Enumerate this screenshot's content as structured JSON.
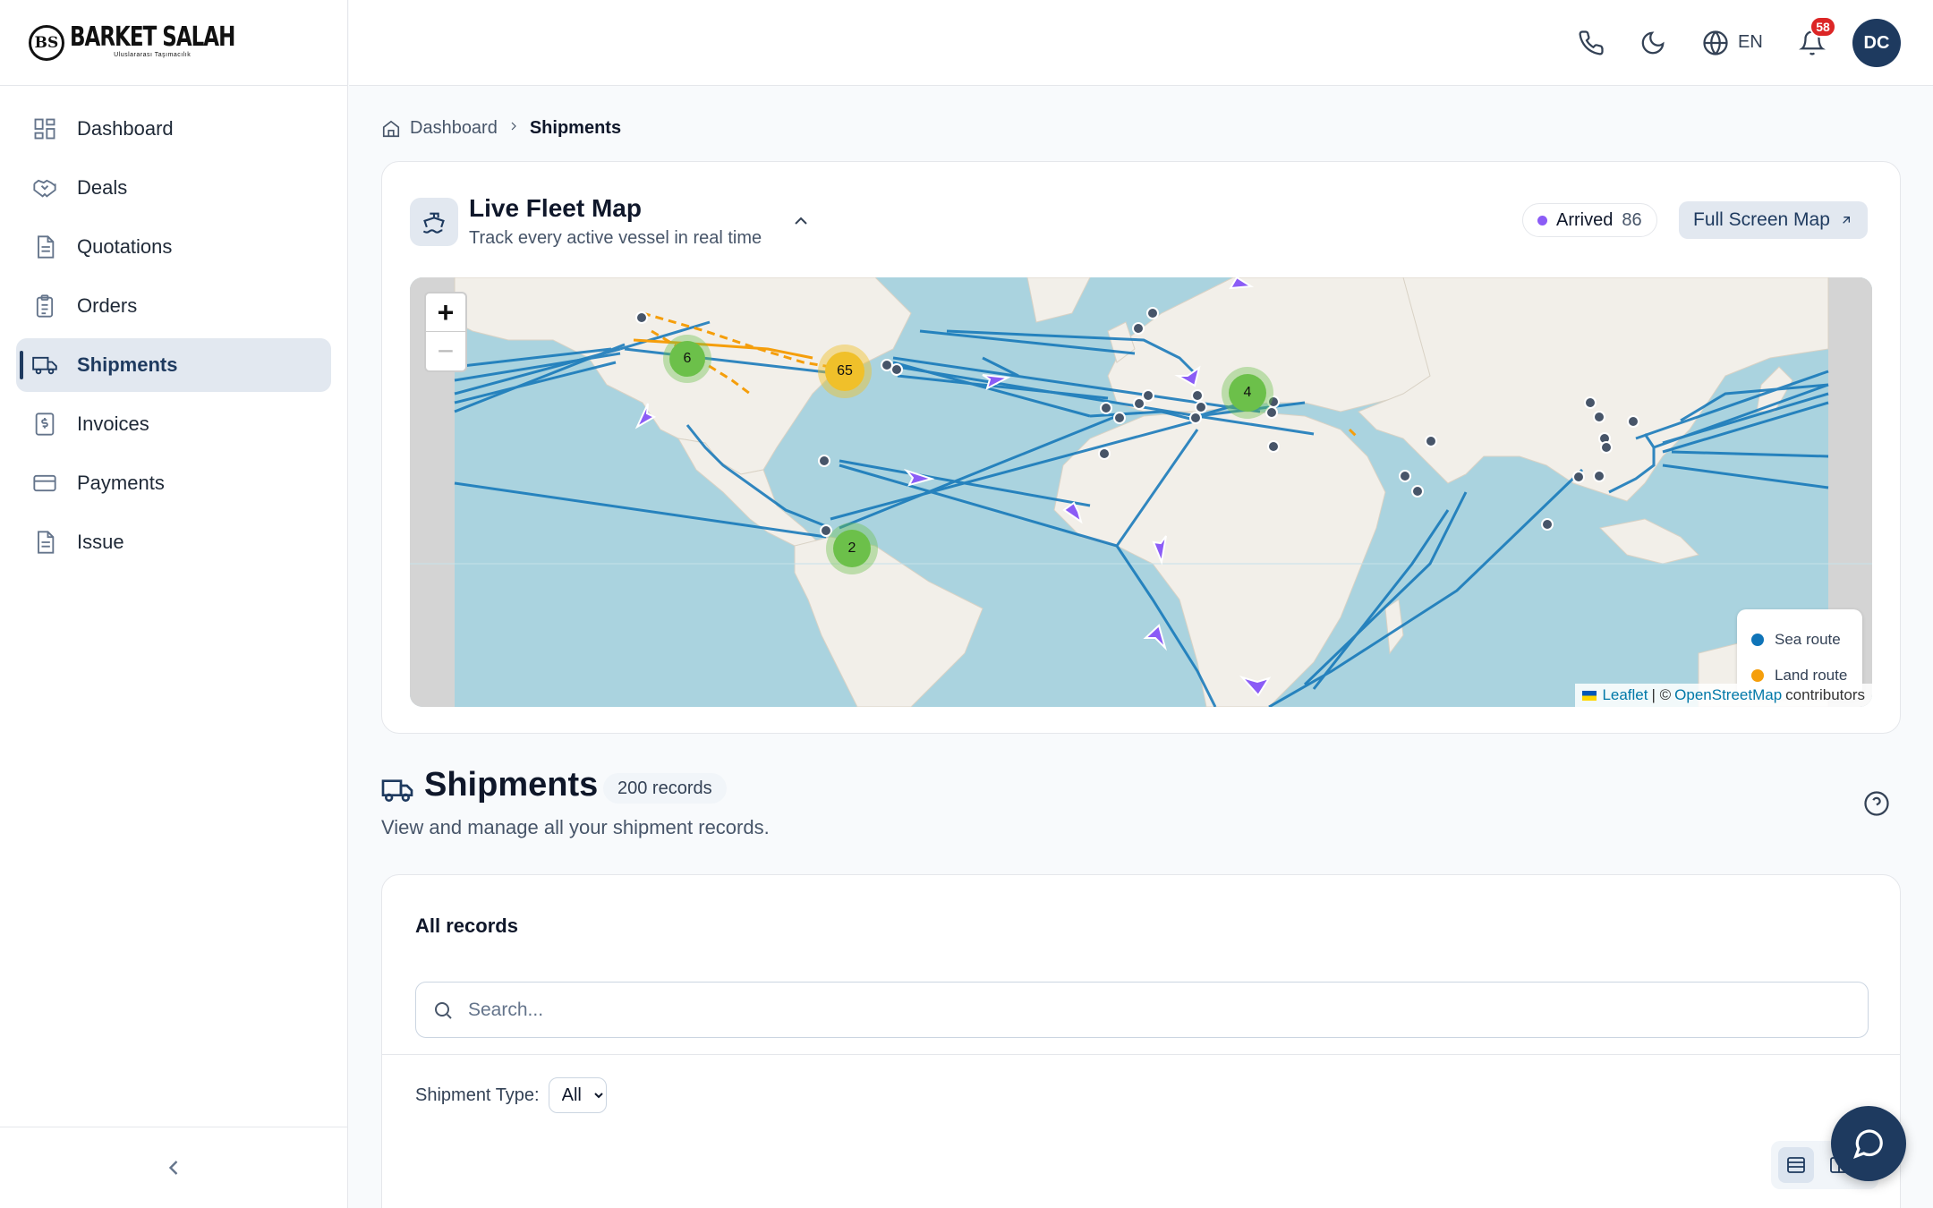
{
  "brand": {
    "mark": "BS",
    "name": "BARKET SALAH",
    "tagline": "Uluslararası Taşımacılık"
  },
  "sidebar": {
    "items": [
      {
        "label": "Dashboard",
        "icon": "dashboard-icon"
      },
      {
        "label": "Deals",
        "icon": "handshake-icon"
      },
      {
        "label": "Quotations",
        "icon": "document-icon"
      },
      {
        "label": "Orders",
        "icon": "clipboard-icon"
      },
      {
        "label": "Shipments",
        "icon": "truck-icon",
        "active": true
      },
      {
        "label": "Invoices",
        "icon": "invoice-icon"
      },
      {
        "label": "Payments",
        "icon": "card-icon"
      },
      {
        "label": "Issue",
        "icon": "file-icon"
      }
    ]
  },
  "header": {
    "language": "EN",
    "notification_count": "58",
    "avatar_initials": "DC"
  },
  "breadcrumb": {
    "home": "Dashboard",
    "current": "Shipments"
  },
  "map_card": {
    "title": "Live Fleet Map",
    "subtitle": "Track every active vessel in real time",
    "arrived_label": "Arrived",
    "arrived_count": "86",
    "full_screen_label": "Full Screen Map",
    "zoom_in": "+",
    "zoom_out": "−",
    "clusters": [
      {
        "count": "6",
        "color": "#6cc04a"
      },
      {
        "count": "65",
        "color": "#f0c02a"
      },
      {
        "count": "4",
        "color": "#6cc04a"
      },
      {
        "count": "2",
        "color": "#6cc04a"
      }
    ],
    "legend": {
      "sea_label": "Sea route",
      "sea_color": "#0f74b8",
      "land_label": "Land route",
      "land_color": "#f59e0b"
    },
    "attribution": {
      "leaflet": "Leaflet",
      "sep": "| ©",
      "osm": "OpenStreetMap",
      "suffix": "contributors"
    }
  },
  "shipments": {
    "title": "Shipments",
    "records_badge": "200 records",
    "subtitle": "View and manage all your shipment records.",
    "card_title": "All records",
    "search_placeholder": "Search...",
    "filter_label": "Shipment Type:",
    "filter_value": "All"
  },
  "colors": {
    "primary": "#1e3a5f",
    "sea": "#aad3df",
    "land": "#f2efe9",
    "vessel": "#8b5cf6"
  }
}
